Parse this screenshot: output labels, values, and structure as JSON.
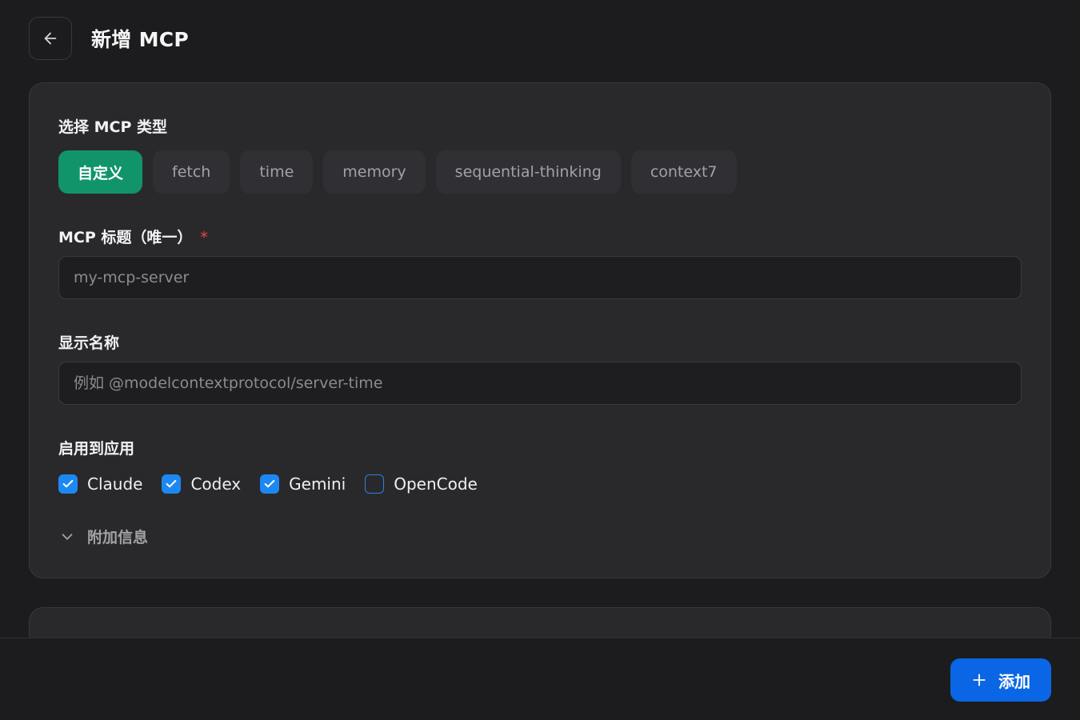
{
  "header": {
    "title": "新增 MCP",
    "back_icon": "arrow-left-icon"
  },
  "type_section": {
    "label": "选择 MCP 类型",
    "options": [
      "自定义",
      "fetch",
      "time",
      "memory",
      "sequential-thinking",
      "context7"
    ],
    "selected": "自定义"
  },
  "title_field": {
    "label": "MCP 标题（唯一）",
    "required_mark": "*",
    "value": "",
    "placeholder": "my-mcp-server"
  },
  "display_name_field": {
    "label": "显示名称",
    "value": "",
    "placeholder": "例如 @modelcontextprotocol/server-time"
  },
  "apps_section": {
    "label": "启用到应用",
    "apps": [
      {
        "label": "Claude",
        "checked": true
      },
      {
        "label": "Codex",
        "checked": true
      },
      {
        "label": "Gemini",
        "checked": true
      },
      {
        "label": "OpenCode",
        "checked": false
      }
    ]
  },
  "extra_info": {
    "label": "附加信息",
    "icon": "chevron-down-icon"
  },
  "footer": {
    "add_label": "添加",
    "add_icon": "plus-icon"
  },
  "colors": {
    "accent_green": "#12946a",
    "accent_blue": "#0a66e4",
    "checkbox_blue": "#1e88f2",
    "required_red": "#ef4444"
  }
}
